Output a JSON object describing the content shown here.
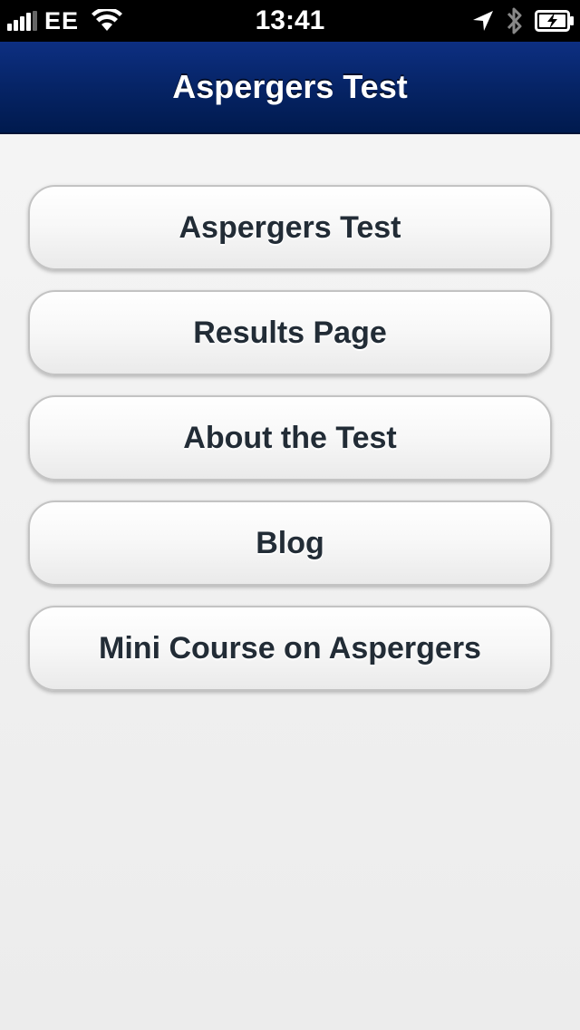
{
  "status_bar": {
    "carrier": "EE",
    "time": "13:41",
    "icons": [
      "signal-icon",
      "wifi-icon",
      "location-arrow-icon",
      "bluetooth-icon",
      "battery-charging-icon"
    ]
  },
  "nav_bar": {
    "title": "Aspergers Test"
  },
  "menu": {
    "items": [
      {
        "label": "Aspergers Test"
      },
      {
        "label": "Results Page"
      },
      {
        "label": "About the Test"
      },
      {
        "label": "Blog"
      },
      {
        "label": "Mini Course on Aspergers"
      }
    ]
  },
  "colors": {
    "nav_bar": "#062466",
    "button_text": "#222c36",
    "background": "#efefef"
  }
}
